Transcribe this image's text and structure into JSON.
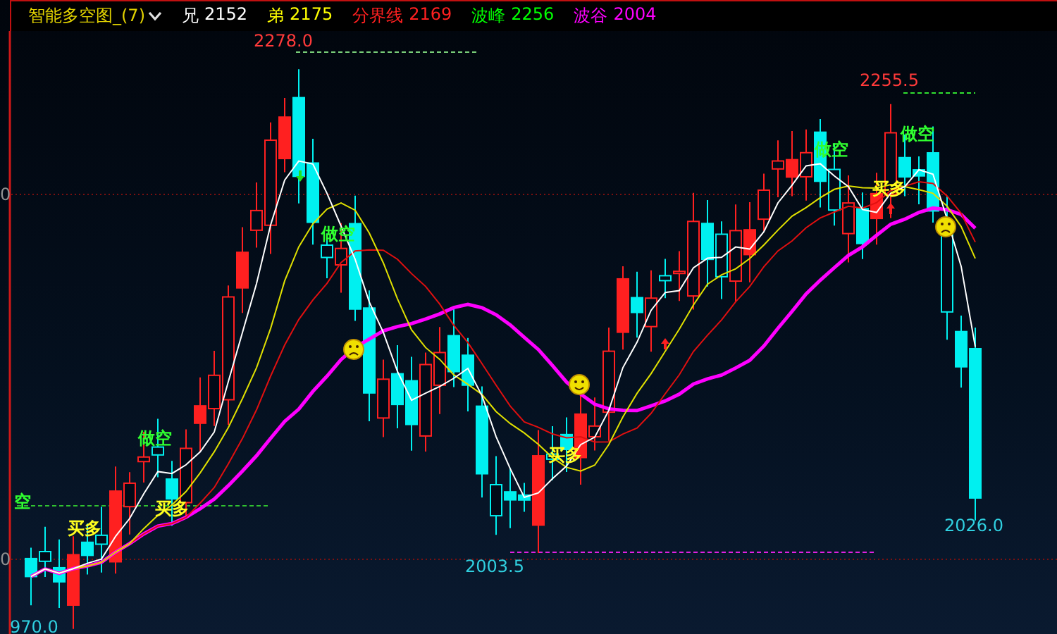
{
  "indicator": {
    "title": "智能多空图_(7)"
  },
  "readouts": [
    {
      "label": "兄",
      "value": "2152",
      "color": "#ffffff"
    },
    {
      "label": "弟",
      "value": "2175",
      "color": "#ffff00"
    },
    {
      "label": "分界线",
      "value": "2169",
      "color": "#ff2020"
    },
    {
      "label": "波峰",
      "value": "2256",
      "color": "#00ff00"
    },
    {
      "label": "波谷",
      "value": "2004",
      "color": "#ff00ff"
    }
  ],
  "chart": {
    "price_labels": [
      {
        "text": "2278.0",
        "kind": "high"
      },
      {
        "text": "2255.5",
        "kind": "high"
      },
      {
        "text": "2003.5",
        "kind": "low"
      },
      {
        "text": "2026.0",
        "kind": "low"
      },
      {
        "text": "970.0",
        "kind": "low"
      },
      {
        "text": "0",
        "kind": "axis"
      },
      {
        "text": "0",
        "kind": "axis"
      }
    ],
    "signals": [
      {
        "kind": "short",
        "text": "空"
      },
      {
        "kind": "long",
        "text": "买多"
      },
      {
        "kind": "short",
        "text": "做空"
      },
      {
        "kind": "long",
        "text": "买多"
      },
      {
        "kind": "short",
        "text": "做空"
      },
      {
        "kind": "long",
        "text": "买多"
      },
      {
        "kind": "short",
        "text": "做空"
      },
      {
        "kind": "long",
        "text": "买多"
      },
      {
        "kind": "short",
        "text": "做空"
      }
    ]
  }
}
